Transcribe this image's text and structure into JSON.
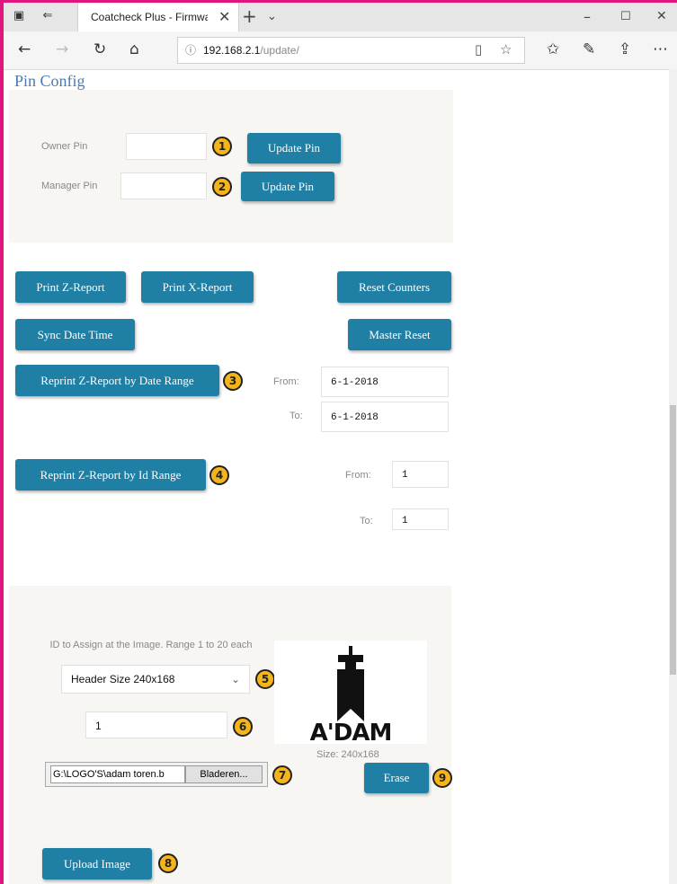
{
  "browser": {
    "tab_title": "Coatcheck Plus - Firmwa",
    "url_host": "192.168.2.1",
    "url_path": "/update/"
  },
  "page": {
    "title": "Pin Config"
  },
  "pins": {
    "owner_label": "Owner Pin",
    "manager_label": "Manager Pin",
    "owner_value": "",
    "manager_value": "",
    "update_owner_button": "Update Pin",
    "update_manager_button": "Update Pin"
  },
  "reports": {
    "print_z": "Print Z-Report",
    "print_x": "Print X-Report",
    "reset_counters": "Reset Counters",
    "sync_date_time": "Sync Date Time",
    "master_reset": "Master Reset",
    "reprint_date_range": "Reprint Z-Report by Date Range",
    "date_from_label": "From:",
    "date_to_label": "To:",
    "date_from_value": "6-1-2018",
    "date_to_value": "6-1-2018",
    "reprint_id_range": "Reprint Z-Report by Id Range",
    "id_from_label": "From:",
    "id_to_label": "To:",
    "id_from_value": "1",
    "id_to_value": "1"
  },
  "image_section": {
    "id_hint": "ID to Assign at the Image. Range 1 to 20 each",
    "size_select": "Header Size 240x168",
    "id_value": "1",
    "file_path": "G:\\LOGO'S\\adam toren.b",
    "browse_button": "Bladeren...",
    "logo_text": "A'DAM",
    "size_caption": "Size: 240x168",
    "erase_button": "Erase",
    "upload_button": "Upload Image"
  },
  "badges": [
    "1",
    "2",
    "3",
    "4",
    "5",
    "6",
    "7",
    "8",
    "9"
  ],
  "colors": {
    "button": "#1f7fa4",
    "badge": "#f4b41a",
    "frame": "#e0157f",
    "title": "#4a7bb0"
  }
}
